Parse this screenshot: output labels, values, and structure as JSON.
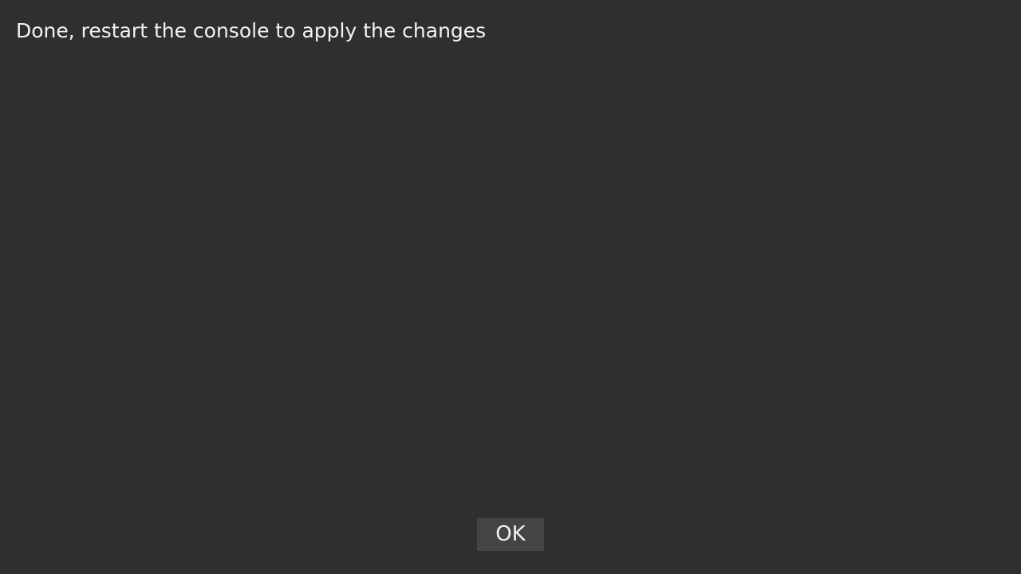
{
  "dialog": {
    "message": "Done, restart the console to apply the changes",
    "ok_label": "OK"
  },
  "colors": {
    "background": "#2f2f2f",
    "button_background": "#444444",
    "text": "#f2f2f2"
  }
}
